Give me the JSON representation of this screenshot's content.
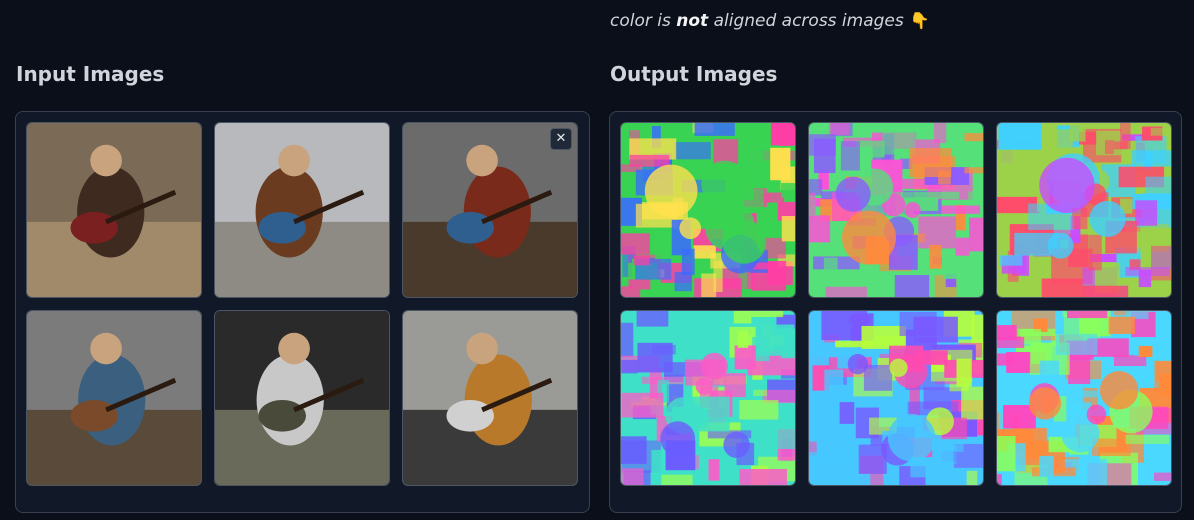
{
  "note": {
    "prefix": "color is ",
    "emphasis": "not",
    "suffix": " aligned across images",
    "emoji": "👇"
  },
  "input_panel": {
    "title": "Input Images",
    "close_label": "✕",
    "images": [
      {
        "label": "input-image-1",
        "theme": [
          "#7b6a55",
          "#a08a6a",
          "#3e2a1e",
          "#7a2020"
        ]
      },
      {
        "label": "input-image-2",
        "theme": [
          "#b7b9bd",
          "#8e8b84",
          "#6a3b1f",
          "#2f5f8f"
        ]
      },
      {
        "label": "input-image-3",
        "theme": [
          "#6b6b6b",
          "#4a3a2b",
          "#7a2a1a",
          "#2f5f8f"
        ]
      },
      {
        "label": "input-image-4",
        "theme": [
          "#7b7b7b",
          "#5a4a3a",
          "#3a5f7f",
          "#7a4a2a"
        ]
      },
      {
        "label": "input-image-5",
        "theme": [
          "#2a2a2a",
          "#6a6a5a",
          "#c8c8c8",
          "#4a4a3a"
        ]
      },
      {
        "label": "input-image-6",
        "theme": [
          "#9a9a96",
          "#3a3a3a",
          "#b87a2a",
          "#d0d0d0"
        ]
      }
    ]
  },
  "output_panel": {
    "title": "Output Images",
    "images": [
      {
        "label": "output-image-1",
        "theme": [
          "#39d353",
          "#ff3ea5",
          "#3a6bff",
          "#ffe14d"
        ]
      },
      {
        "label": "output-image-2",
        "theme": [
          "#56e07a",
          "#ff4fd8",
          "#ff8a3d",
          "#8a5cff"
        ]
      },
      {
        "label": "output-image-3",
        "theme": [
          "#9bd24a",
          "#c94cff",
          "#3ed0ff",
          "#ff4a6b"
        ]
      },
      {
        "label": "output-image-4",
        "theme": [
          "#3fe0c8",
          "#ff5ac8",
          "#a2ff4a",
          "#6a5cff"
        ]
      },
      {
        "label": "output-image-5",
        "theme": [
          "#46c8ff",
          "#ff4ab0",
          "#b6ff3a",
          "#7a58ff"
        ]
      },
      {
        "label": "output-image-6",
        "theme": [
          "#4ad8ff",
          "#ff46c0",
          "#8aff5a",
          "#ff8a3a"
        ]
      }
    ]
  }
}
